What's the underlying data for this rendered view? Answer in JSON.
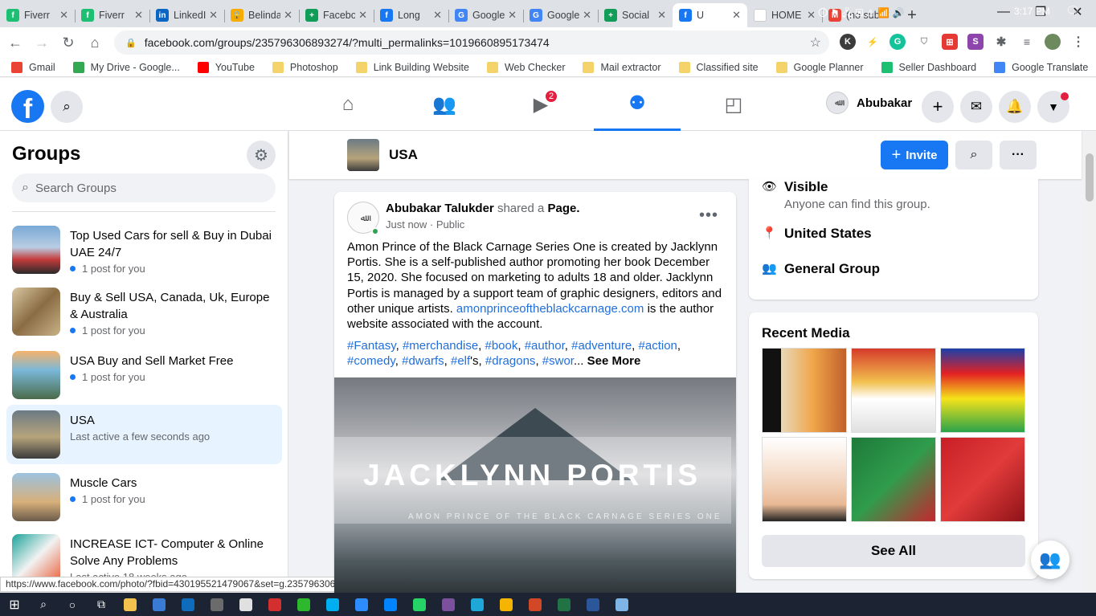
{
  "browser": {
    "tabs": [
      {
        "label": "Fiverr",
        "fav_color": "#1dbf73",
        "fav_text": "f"
      },
      {
        "label": "Fiverr",
        "fav_color": "#1dbf73",
        "fav_text": "f"
      },
      {
        "label": "LinkedIn",
        "fav_color": "#0a66c2",
        "fav_text": "in"
      },
      {
        "label": "Belinda",
        "fav_color": "#f9ab00",
        "fav_text": "🔒"
      },
      {
        "label": "Facebook",
        "fav_color": "#0f9d58",
        "fav_text": "+"
      },
      {
        "label": "Long",
        "fav_color": "#1877f2",
        "fav_text": "f"
      },
      {
        "label": "Google",
        "fav_color": "#4285f4",
        "fav_text": "G"
      },
      {
        "label": "Google",
        "fav_color": "#4285f4",
        "fav_text": "G"
      },
      {
        "label": "Social",
        "fav_color": "#0f9d58",
        "fav_text": "+"
      },
      {
        "label": "U",
        "fav_color": "#1877f2",
        "fav_text": "f",
        "active": true
      },
      {
        "label": "HOME",
        "fav_color": "#ffffff",
        "fav_text": ""
      },
      {
        "label": "(no subject)",
        "fav_color": "#ea4335",
        "fav_text": "M"
      }
    ],
    "url": "facebook.com/groups/235796306893274/?multi_permalinks=1019660895173474",
    "bookmarks": [
      {
        "label": "Gmail",
        "color": "#ea4335"
      },
      {
        "label": "My Drive - Google...",
        "color": "#34a853"
      },
      {
        "label": "YouTube",
        "color": "#ff0000"
      },
      {
        "label": "Photoshop",
        "color": "folder"
      },
      {
        "label": "Link Building Website",
        "color": "folder"
      },
      {
        "label": "Web Checker",
        "color": "folder"
      },
      {
        "label": "Mail extractor",
        "color": "folder"
      },
      {
        "label": "Classified site",
        "color": "folder"
      },
      {
        "label": "Google Planner",
        "color": "folder"
      },
      {
        "label": "Seller Dashboard",
        "color": "#1dbf73"
      },
      {
        "label": "Google Translate",
        "color": "#4285f4"
      }
    ],
    "more_bookmarks": "»",
    "status_url": "https://www.facebook.com/photo/?fbid=430195521479067&set=g.23579630689..."
  },
  "facebook": {
    "user_name": "Abubakar",
    "watch_badge": "2",
    "sidebar": {
      "title": "Groups",
      "search_placeholder": "Search Groups",
      "groups": [
        {
          "name": "Top Used Cars for sell & Buy in Dubai UAE 24/7",
          "sub": "1 post for you",
          "dot": true,
          "thumb": "linear-gradient(180deg,#7aa9d6 0%,#b9cde3 45%,#c43b3b 70%,#2a2a2a 100%)"
        },
        {
          "name": "Buy & Sell USA, Canada, Uk, Europe & Australia",
          "sub": "1 post for you",
          "dot": true,
          "thumb": "linear-gradient(135deg,#d9c7a2 0%,#8a6c43 50%,#c9b287 100%)"
        },
        {
          "name": "USA Buy and Sell Market Free",
          "sub": "1 post for you",
          "dot": true,
          "thumb": "linear-gradient(180deg,#f6b26b 0%,#7ab8d9 40%,#4a6b4a 100%)"
        },
        {
          "name": "USA",
          "sub": "Last active a few seconds ago",
          "dot": false,
          "selected": true,
          "thumb": "linear-gradient(180deg,#6b7a84 0%,#b7a47c 55%,#3b3b3b 100%)"
        },
        {
          "name": "Muscle Cars",
          "sub": "1 post for you",
          "dot": true,
          "thumb": "linear-gradient(180deg,#9cc2e0 0%,#d8b07a 60%,#6b5b4b 100%)"
        },
        {
          "name": "INCREASE ICT- Computer & Online Solve Any Problems",
          "sub": "Last active 18 weeks ago",
          "dot": false,
          "thumb": "linear-gradient(135deg,#1aa39a 0%,#f2f2f2 50%,#e9603b 100%)"
        }
      ]
    },
    "group_header": {
      "name": "USA",
      "invite_label": "Invite"
    },
    "post": {
      "author": "Abubakar Talukder",
      "action": "shared a",
      "object": "Page",
      "time": "Just now",
      "privacy": "Public",
      "text": "Amon Prince of the Black Carnage Series One is created by Jacklynn Portis. She is a self-published author promoting her book December 15, 2020. She focused on marketing to adults 18 and older. Jacklynn Portis is managed by a support team of graphic designers, editors and other unique artists.",
      "link": "amonprinceoftheblackcarnage.com",
      "text_after": "is the author website associated with the account.",
      "tags": [
        "#Fantasy",
        "#merchandise",
        "#book",
        "#author",
        "#adventure",
        "#action",
        "#comedy",
        "#dwarfs",
        "#elf"
      ],
      "tag_suffix_elf": "'s,",
      "tag_cut": "#dragons",
      "tag_trunc": "#swor",
      "see_more": "See More",
      "image_title": "JACKLYNN PORTIS",
      "image_subtitle": "AMON PRINCE OF THE BLACK CARNAGE SERIES ONE"
    },
    "about": {
      "visible_title": "Visible",
      "visible_sub": "Anyone can find this group.",
      "location": "United States",
      "type": "General Group"
    },
    "media": {
      "title": "Recent Media",
      "see_all": "See All",
      "thumbs": [
        "linear-gradient(90deg,#111 0%,#111 22%,#e8d9b9 22%,#f0a64b 60%,#c0602a 100%)",
        "linear-gradient(180deg,#d63a2a 0%,#f2c14e 40%,#ffffff 60%,#e0e0e0 100%)",
        "linear-gradient(180deg,#1c3faa 0%,#e32222 30%,#f5e31a 60%,#2aa34a 100%)",
        "linear-gradient(180deg,#ffffff 0%,#f3d7c2 50%,#e9b995 80%,#222 100%)",
        "linear-gradient(135deg,#1e7a3a 0%,#2f9c4c 50%,#c6262e 100%)",
        "linear-gradient(135deg,#c71f26 0%,#e23b3b 50%,#8f1318 100%)"
      ]
    }
  },
  "taskbar": {
    "time": "3:17 PM",
    "apps": [
      {
        "name": "file-explorer-icon",
        "color": "#f2c14e"
      },
      {
        "name": "store-icon",
        "color": "#3a7bd5"
      },
      {
        "name": "mail-icon",
        "color": "#0f6cbd"
      },
      {
        "name": "calculator-icon",
        "color": "#6b6b6b"
      },
      {
        "name": "snipping-icon",
        "color": "#e0e0e0"
      },
      {
        "name": "pdf-icon",
        "color": "#d32f2f"
      },
      {
        "name": "camtasia-icon",
        "color": "#2eb82e"
      },
      {
        "name": "skype-icon",
        "color": "#00aff0"
      },
      {
        "name": "zoom-icon",
        "color": "#2d8cff"
      },
      {
        "name": "messenger-icon",
        "color": "#0084ff"
      },
      {
        "name": "whatsapp-icon",
        "color": "#25d366"
      },
      {
        "name": "viber-icon",
        "color": "#7b519d"
      },
      {
        "name": "edge-icon",
        "color": "#1fa7d8"
      },
      {
        "name": "chrome-icon",
        "color": "#f4b400"
      },
      {
        "name": "powerpoint-icon",
        "color": "#d24726"
      },
      {
        "name": "excel-icon",
        "color": "#217346"
      },
      {
        "name": "word-icon",
        "color": "#2b579a"
      },
      {
        "name": "notepad-icon",
        "color": "#7fb5e6"
      }
    ]
  }
}
